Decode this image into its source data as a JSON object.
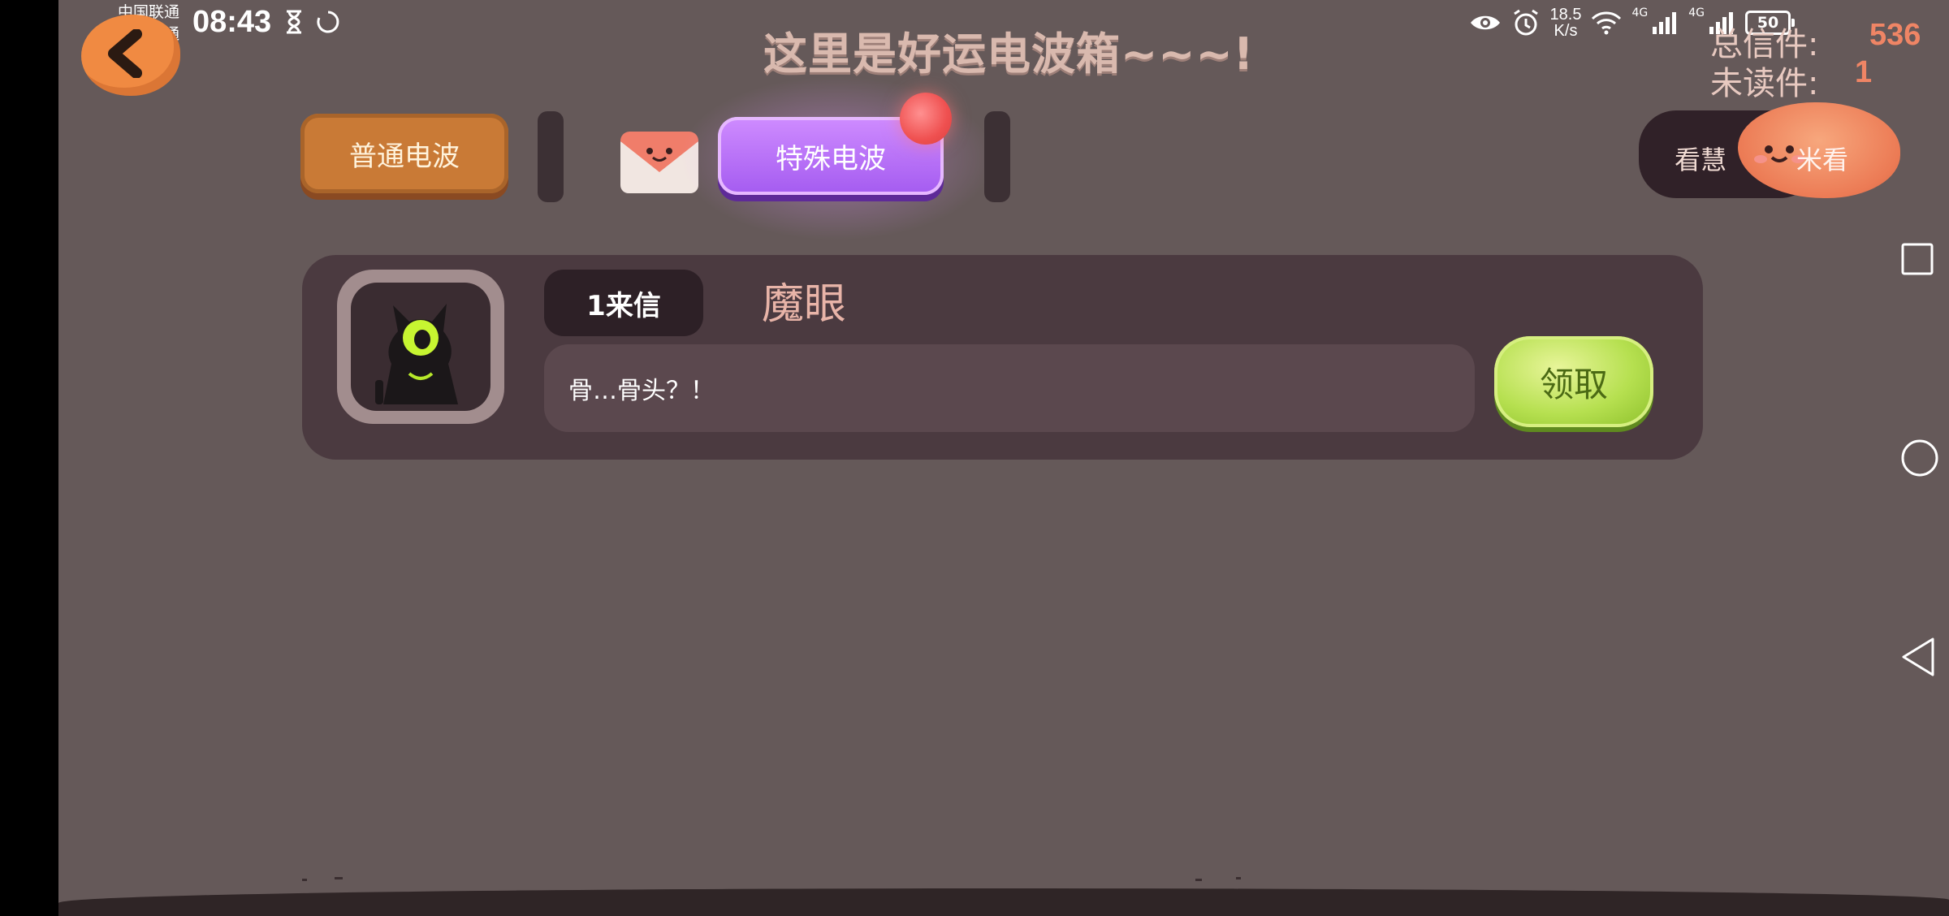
{
  "status_bar": {
    "carrier_1": "中国联通",
    "carrier_2": "中国联通",
    "time": "08:43",
    "speed_value": "18.5",
    "speed_unit": "K/s",
    "signal_label_1": "4G",
    "signal_label_2": "4G",
    "battery": "50"
  },
  "header": {
    "title": "这里是好运电波箱~~~!",
    "total_label": "总信件:",
    "total_value": "536",
    "unread_label": "未读件:",
    "unread_value": "1"
  },
  "tabs": {
    "normal": "普通电波",
    "special": "特殊电波"
  },
  "view_button": {
    "left_text": "看慧",
    "right_text": "米看"
  },
  "letter": {
    "badge": "1来信",
    "sender": "魔眼",
    "message": "骨…骨头？！",
    "claim": "领取"
  },
  "icons": {
    "back": "back-arrow-icon",
    "mail": "mail-icon",
    "nav_recent": "square-icon",
    "nav_home": "circle-icon",
    "nav_back": "triangle-back-icon"
  },
  "colors": {
    "background": "#655959",
    "title": "#d9b9ae",
    "tab_normal": "#c97a36",
    "tab_special": "#b56af7",
    "claim": "#b6e050",
    "counter_value": "#ef8565"
  }
}
